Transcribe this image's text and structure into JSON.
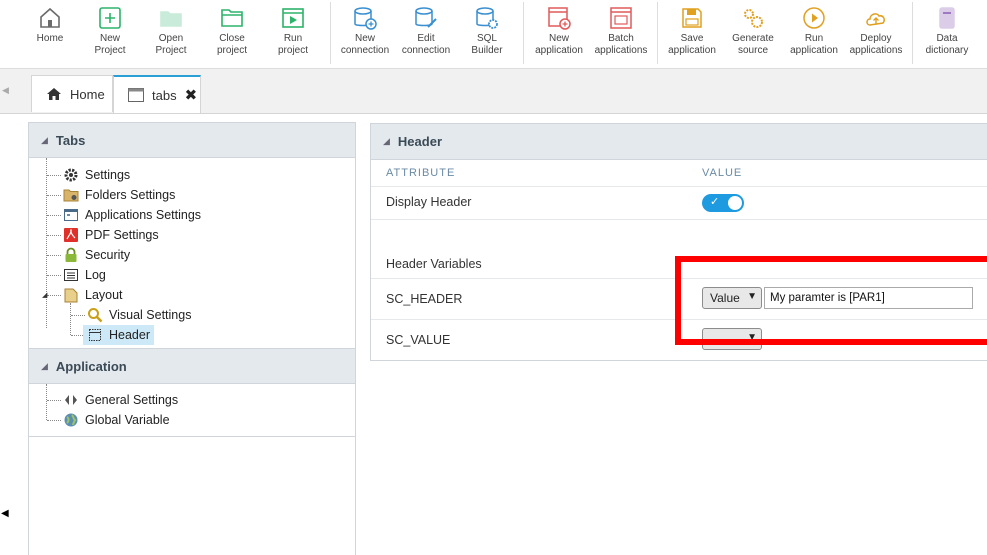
{
  "toolbar": {
    "items": [
      {
        "id": "home",
        "line1": "Home",
        "line2": "",
        "color": "#6b6b6b"
      },
      {
        "id": "new-project",
        "line1": "New",
        "line2": "Project",
        "color": "#2db36a"
      },
      {
        "id": "open-project",
        "line1": "Open",
        "line2": "Project",
        "color": "#2db36a"
      },
      {
        "id": "close-project",
        "line1": "Close",
        "line2": "project",
        "color": "#2db36a"
      },
      {
        "id": "run-project",
        "line1": "Run",
        "line2": "project",
        "color": "#2db36a"
      },
      {
        "id": "new-connection",
        "line1": "New",
        "line2": "connection",
        "color": "#3a8fd0"
      },
      {
        "id": "edit-connection",
        "line1": "Edit",
        "line2": "connection",
        "color": "#3a8fd0"
      },
      {
        "id": "sql-builder",
        "line1": "SQL",
        "line2": "Builder",
        "color": "#3a8fd0"
      },
      {
        "id": "new-application",
        "line1": "New",
        "line2": "application",
        "color": "#e05a5a"
      },
      {
        "id": "batch-applications",
        "line1": "Batch",
        "line2": "applications",
        "color": "#e05a5a"
      },
      {
        "id": "save-application",
        "line1": "Save",
        "line2": "application",
        "color": "#e0a020"
      },
      {
        "id": "generate-source",
        "line1": "Generate",
        "line2": "source",
        "color": "#e0a020"
      },
      {
        "id": "run-application",
        "line1": "Run",
        "line2": "application",
        "color": "#e0a020"
      },
      {
        "id": "deploy-applications",
        "line1": "Deploy",
        "line2": "applications",
        "color": "#e0a020"
      },
      {
        "id": "data-dictionary",
        "line1": "Data",
        "line2": "dictionary",
        "color": "#8a5bb5"
      }
    ]
  },
  "tabs": [
    {
      "label": "Home"
    },
    {
      "label": "tabs"
    }
  ],
  "left": {
    "tabs_section": "Tabs",
    "tabs_items": [
      "Settings",
      "Folders Settings",
      "Applications Settings",
      "PDF Settings",
      "Security",
      "Log",
      "Layout",
      "Visual Settings",
      "Header"
    ],
    "app_section": "Application",
    "app_items": [
      "General Settings",
      "Global Variable"
    ]
  },
  "right": {
    "title": "Header",
    "col_attribute": "ATTRIBUTE",
    "col_value": "VALUE",
    "display_header": "Display Header",
    "toggle_mark": "✓",
    "header_variables": "Header Variables",
    "sc_header": "SC_HEADER",
    "sc_header_type": "Value",
    "sc_header_value": "My paramter is [PAR1]",
    "sc_value": "SC_VALUE",
    "sc_value_type": ""
  }
}
